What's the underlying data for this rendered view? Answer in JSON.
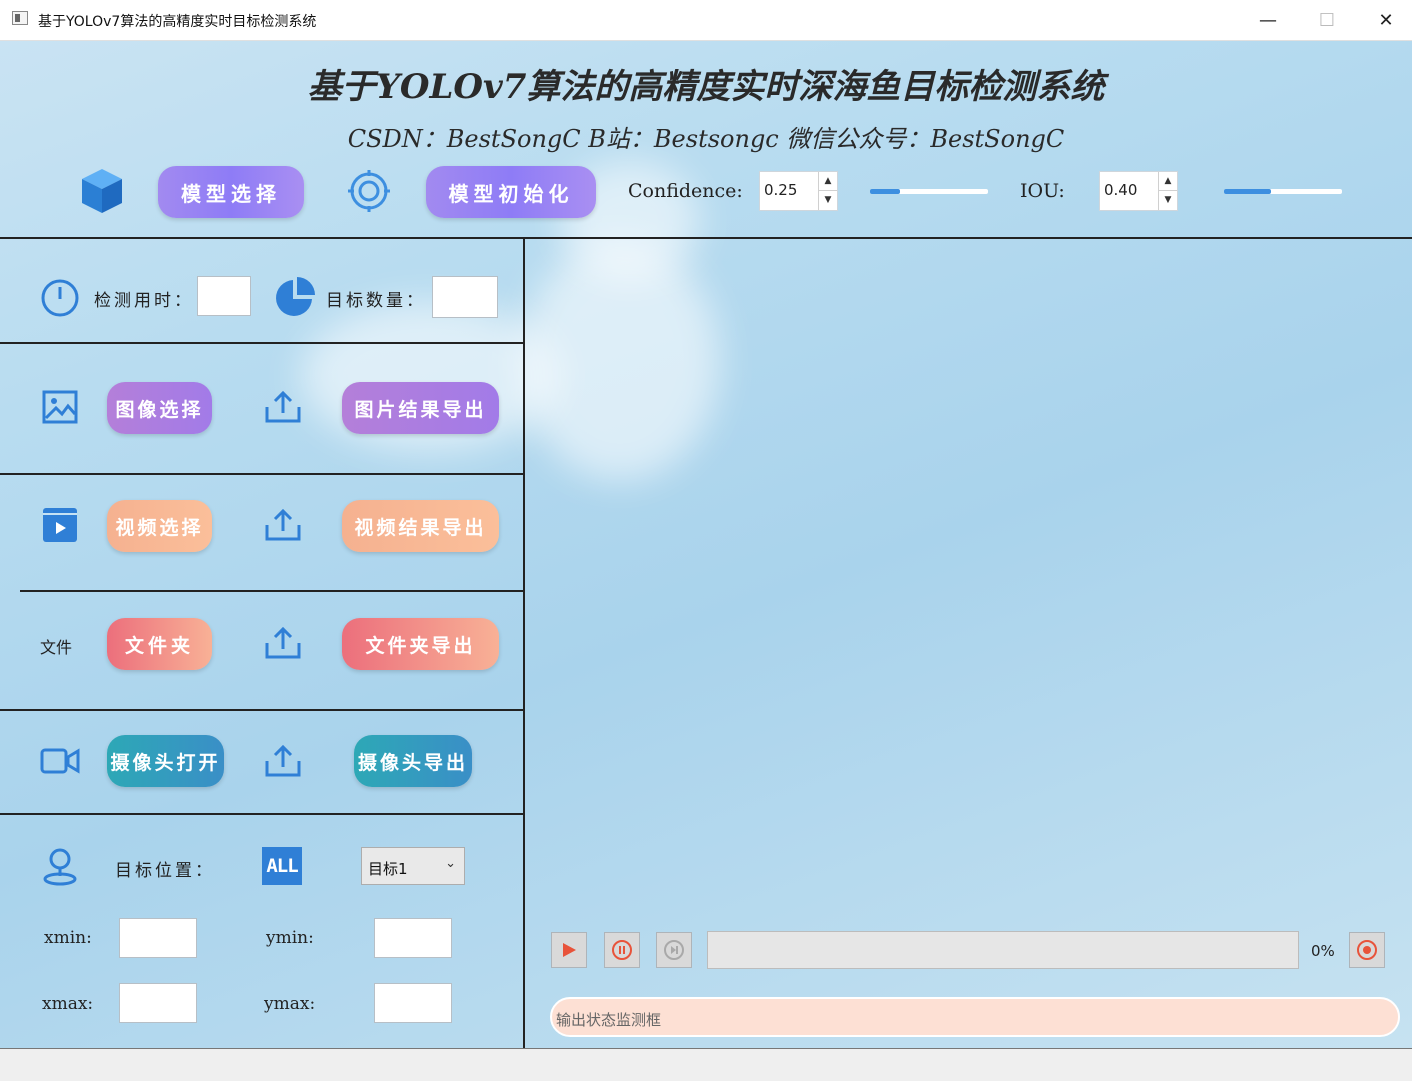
{
  "window": {
    "title": "基于YOLOv7算法的高精度实时目标检测系统",
    "minimize_glyph": "—",
    "maximize_glyph": "☐",
    "close_glyph": "✕"
  },
  "header": {
    "title": "基于YOLOv7算法的高精度实时深海鱼目标检测系统",
    "subtitle": "CSDN：BestSongC B站：Bestsongc 微信公众号：BestSongC"
  },
  "toolbar": {
    "model_select_label": "模型选择",
    "model_init_label": "模型初始化",
    "confidence_label": "Confidence:",
    "confidence_value": "0.25",
    "confidence_level": 0.25,
    "iou_label": "IOU:",
    "iou_value": "0.40",
    "iou_level": 0.4
  },
  "stats": {
    "time_label": "检测用时：",
    "time_value": "",
    "count_label": "目标数量：",
    "count_value": ""
  },
  "image_row": {
    "select_label": "图像选择",
    "export_label": "图片结果导出"
  },
  "video_row": {
    "select_label": "视频选择",
    "export_label": "视频结果导出"
  },
  "folder_row": {
    "icon_text": "文件",
    "select_label": "文件夹",
    "export_label": "文件夹导出"
  },
  "camera_row": {
    "select_label": "摄像头打开",
    "export_label": "摄像头导出"
  },
  "position": {
    "label": "目标位置：",
    "all_badge": "ALL",
    "target_select": "目标1",
    "xmin_label": "xmin:",
    "ymin_label": "ymin:",
    "xmax_label": "xmax:",
    "ymax_label": "ymax:",
    "xmin": "",
    "ymin": "",
    "xmax": "",
    "ymax": ""
  },
  "player": {
    "progress_text": "0%",
    "progress_level": 0,
    "status_placeholder": "输出状态监测框"
  },
  "colors": {
    "accent_blue": "#3d8fe0",
    "icon_blue": "#2f7fd6",
    "media_red": "#e8533a",
    "status_box": "#fde0d4"
  }
}
